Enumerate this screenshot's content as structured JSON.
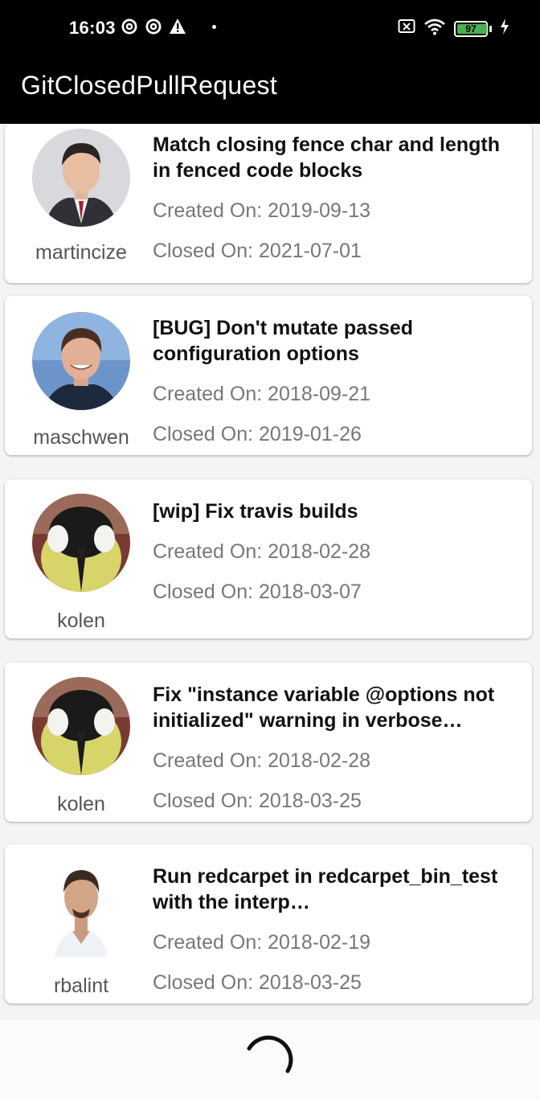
{
  "status_bar": {
    "time": "16:03",
    "battery_level": "97",
    "battery_fill_fraction": 0.97,
    "left_icons": [
      "at-sign-icon",
      "at-sign-icon",
      "warning-icon",
      "dot-icon"
    ],
    "right_icons": [
      "sim-x-icon",
      "wifi-icon",
      "battery-icon",
      "charging-bolt-icon"
    ]
  },
  "app_bar": {
    "title": "GitClosedPullRequest"
  },
  "pull_requests": [
    {
      "username": "martincize",
      "title": "Match closing fence char and length in fenced code blocks",
      "created": "Created On: 2019-09-13",
      "closed": "Closed On: 2021-07-01"
    },
    {
      "username": "maschwen",
      "title": "[BUG] Don't mutate passed configuration options",
      "created": "Created On: 2018-09-21",
      "closed": "Closed On: 2019-01-26"
    },
    {
      "username": "kolen",
      "title": "[wip] Fix travis builds",
      "created": "Created On: 2018-02-28",
      "closed": "Closed On: 2018-03-07"
    },
    {
      "username": "kolen",
      "title": "Fix \"instance variable @options not initialized\" warning in verbose…",
      "created": "Created On: 2018-02-28",
      "closed": "Closed On: 2018-03-25"
    },
    {
      "username": "rbalint",
      "title": "Run redcarpet in redcarpet_bin_test with the interp…",
      "created": "Created On: 2018-02-19",
      "closed": "Closed On: 2018-03-25"
    }
  ],
  "colors": {
    "app_bar": "#000000",
    "card": "#ffffff",
    "title_text": "#111111",
    "meta_text": "#777777",
    "battery": "#4caf50"
  },
  "loading_indicator": "spinner"
}
